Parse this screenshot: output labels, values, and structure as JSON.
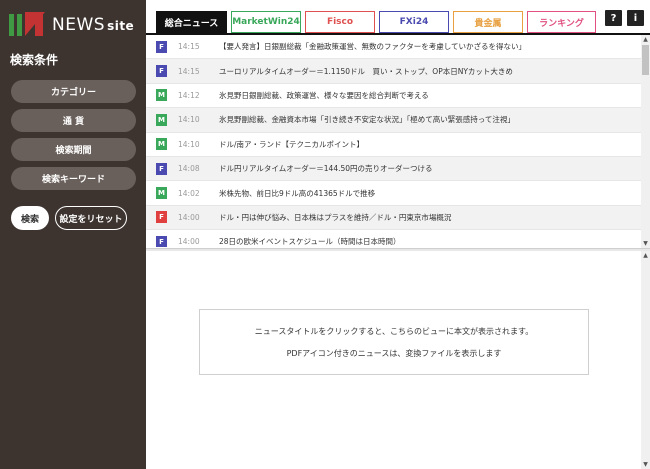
{
  "logo": {
    "text": "NEWS",
    "suffix": "site"
  },
  "sidebar": {
    "title": "検索条件",
    "buttons": [
      "カテゴリー",
      "通 貨",
      "検索期間",
      "検索キーワード"
    ],
    "search_label": "検索",
    "reset_label": "設定をリセット"
  },
  "tabs": [
    {
      "label": "総合ニュース",
      "color": "#111111",
      "active": true
    },
    {
      "label": "MarketWin24",
      "color": "#3aa85a",
      "active": false
    },
    {
      "label": "Fisco",
      "color": "#e05050",
      "active": false
    },
    {
      "label": "FXi24",
      "color": "#4a4ab0",
      "active": false
    },
    {
      "label": "貴金属",
      "color": "#e8a040",
      "active": false
    },
    {
      "label": "ランキング",
      "color": "#e05080",
      "active": false
    }
  ],
  "icons": {
    "help": "?",
    "info": "i"
  },
  "badge_colors": {
    "F": "#4a4ab0",
    "M": "#3aa85a",
    "R": "#e04040"
  },
  "news": [
    {
      "badge": "F",
      "type": "F",
      "time": "14:15",
      "title": "【要人発言】日銀副総裁「金融政策運営、無数のファクターを考慮していかざるを得ない」"
    },
    {
      "badge": "F",
      "type": "F",
      "time": "14:15",
      "title": "ユーロリアルタイムオーダー＝1.1150ドル　買い・ストップ、OP本日NYカット大きめ"
    },
    {
      "badge": "M",
      "type": "M",
      "time": "14:12",
      "title": "氷見野日銀副総裁、政策運営、様々な要因を総合判断で考える"
    },
    {
      "badge": "M",
      "type": "M",
      "time": "14:10",
      "title": "氷見野副総裁、金融資本市場「引き続き不安定な状況」「極めて高い緊張感持って注視」"
    },
    {
      "badge": "M",
      "type": "M",
      "time": "14:10",
      "title": "ドル/南ア・ランド【テクニカルポイント】"
    },
    {
      "badge": "F",
      "type": "F",
      "time": "14:08",
      "title": "ドル円リアルタイムオーダー＝144.50円の売りオーダーつける"
    },
    {
      "badge": "M",
      "type": "M",
      "time": "14:02",
      "title": "米株先物、前日比9ドル高の41365ドルで推移"
    },
    {
      "badge": "F",
      "type": "R",
      "time": "14:00",
      "title": "ドル・円は伸び悩み、日本株はプラスを維持／ドル・円東京市場概況"
    },
    {
      "badge": "F",
      "type": "F",
      "time": "14:00",
      "title": "28日の欧米イベントスケジュール（時間は日本時間）"
    }
  ],
  "preview": {
    "line1": "ニュースタイトルをクリックすると、こちらのビューに本文が表示されます。",
    "line2": "PDFアイコン付きのニュースは、変換ファイルを表示します"
  }
}
